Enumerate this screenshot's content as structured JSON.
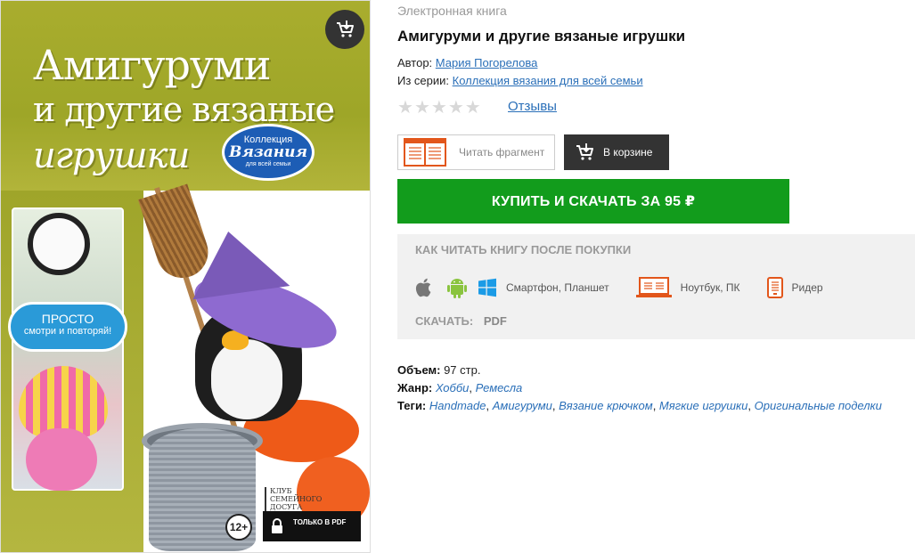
{
  "cover": {
    "title_line1": "Амигуруми",
    "title_line2": "и другие вязаные",
    "title_line3": "игрушки",
    "series_top": "Коллекция",
    "series_main": "Вязания",
    "series_bottom": "для всей семьи",
    "cloud_line1": "ПРОСТО",
    "cloud_line2": "смотри и повторяй!",
    "publisher": "КЛУБ СЕМЕЙНОГО ДОСУГА",
    "age_rating": "12+",
    "pdf_only": "ТОЛЬКО В PDF"
  },
  "book": {
    "type_label": "Электронная книга",
    "title": "Амигуруми и другие вязаные игрушки",
    "author_label": "Автор:",
    "author": "Мария Погорелова",
    "series_label": "Из серии:",
    "series": "Коллекция вязания для всей семьи",
    "rating_stars": 0,
    "reviews_label": "Отзывы"
  },
  "actions": {
    "read_fragment": "Читать фрагмент",
    "in_cart": "В корзине",
    "buy": "КУПИТЬ И СКАЧАТЬ ЗА 95 ₽"
  },
  "howto": {
    "title": "КАК ЧИТАТЬ КНИГУ ПОСЛЕ ПОКУПКИ",
    "smartphone": "Смартфон, Планшет",
    "laptop": "Ноутбук, ПК",
    "reader": "Ридер",
    "download_label": "СКАЧАТЬ:",
    "download_format": "PDF"
  },
  "details": {
    "volume_label": "Объем:",
    "volume": "97 стр.",
    "genre_label": "Жанр:",
    "genres": [
      "Хобби",
      "Ремесла"
    ],
    "tags_label": "Теги:",
    "tags": [
      "Handmade",
      "Амигуруми",
      "Вязание крючком",
      "Мягкие игрушки",
      "Оригинальные поделки"
    ]
  },
  "colors": {
    "buy_button": "#129c1c",
    "link": "#2a6fb8",
    "cart_button": "#333333",
    "accent_orange": "#e2561b",
    "cover_green": "#a9ad2e"
  }
}
